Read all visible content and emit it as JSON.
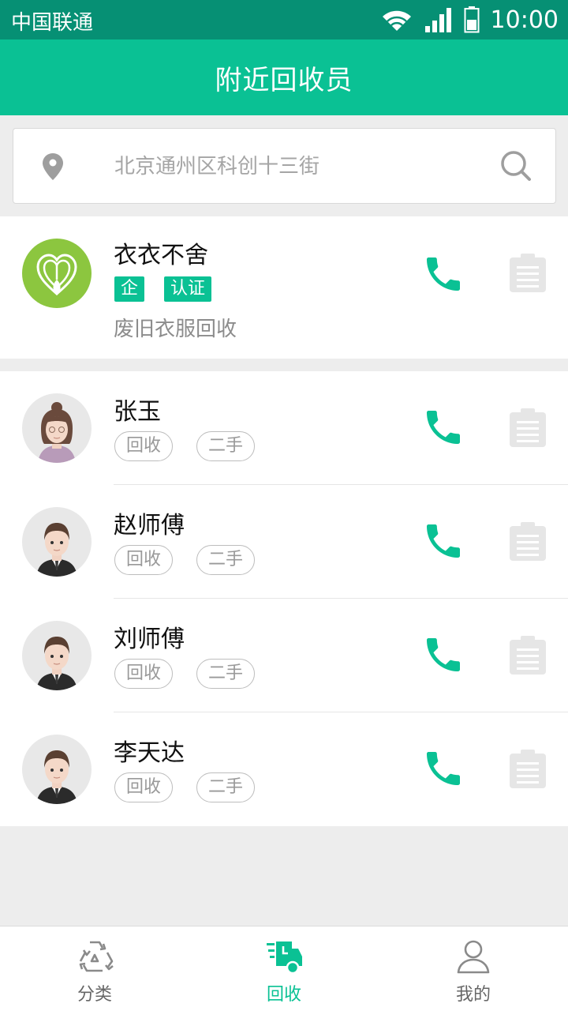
{
  "status_bar": {
    "carrier": "中国联通",
    "time": "10:00"
  },
  "header": {
    "title": "附近回收员"
  },
  "search": {
    "placeholder": "北京通州区科创十三街"
  },
  "enterprise": {
    "name": "衣衣不舍",
    "badges": [
      "企",
      "认证"
    ],
    "description": "废旧衣服回收"
  },
  "collectors": [
    {
      "name": "张玉",
      "tags": [
        "回收",
        "二手"
      ],
      "avatar": "female-avatar"
    },
    {
      "name": "赵师傅",
      "tags": [
        "回收",
        "二手"
      ],
      "avatar": "male-avatar"
    },
    {
      "name": "刘师傅",
      "tags": [
        "回收",
        "二手"
      ],
      "avatar": "male-avatar"
    },
    {
      "name": "李天达",
      "tags": [
        "回收",
        "二手"
      ],
      "avatar": "male-avatar"
    }
  ],
  "tabs": [
    {
      "label": "分类",
      "icon": "recycle-icon",
      "active": false
    },
    {
      "label": "回收",
      "icon": "delivery-truck-icon",
      "active": true
    },
    {
      "label": "我的",
      "icon": "user-icon",
      "active": false
    }
  ],
  "colors": {
    "primary": "#0ac194",
    "status_bar": "#069074",
    "background": "#ededed",
    "enterprise_logo": "#8cc63f"
  }
}
